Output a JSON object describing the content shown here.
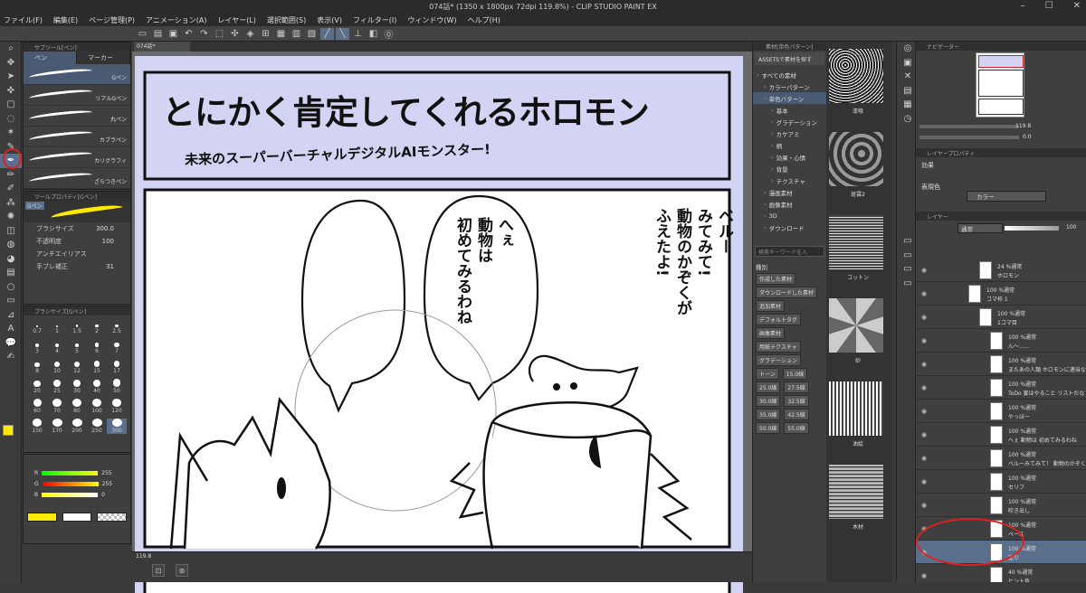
{
  "app": {
    "title": "074話* (1350 x 1800px 72dpi 119.8%) - CLIP STUDIO PAINT EX"
  },
  "menu": [
    "ファイル(F)",
    "編集(E)",
    "ページ管理(P)",
    "アニメーション(A)",
    "レイヤー(L)",
    "選択範囲(S)",
    "表示(V)",
    "フィルター(I)",
    "ウィンドウ(W)",
    "ヘルプ(H)"
  ],
  "tool_panel": {
    "header": "サブツール[ペン]",
    "tabs": [
      "ペン",
      "マーカー"
    ],
    "brushes": [
      "Gペン",
      "リアルGペン",
      "丸ペン",
      "カブラペン",
      "カリグラフィ",
      "ざらつきペン"
    ]
  },
  "tool_property": {
    "header": "ツールプロパティ[Gペン]",
    "brush_name": "Gペン",
    "rows": [
      {
        "label": "ブラシサイズ",
        "value": "300.0"
      },
      {
        "label": "不透明度",
        "value": "100"
      },
      {
        "label": "アンチエイリアス",
        "value": ""
      },
      {
        "label": "手ブレ補正",
        "value": "31"
      }
    ]
  },
  "brush_size": {
    "header": "ブラシサイズ[Gペン]",
    "sizes": [
      "0.7",
      "1",
      "1.5",
      "2",
      "2.5",
      "3",
      "4",
      "5",
      "6",
      "7",
      "8",
      "10",
      "12",
      "15",
      "17",
      "20",
      "25",
      "30",
      "40",
      "50",
      "60",
      "70",
      "80",
      "100",
      "120",
      "150",
      "170",
      "200",
      "250",
      "300"
    ],
    "selected": "300"
  },
  "color": {
    "main": "#ffea00",
    "sub": "#ffffff",
    "rgb": [
      {
        "label": "R",
        "value": "255"
      },
      {
        "label": "G",
        "value": "255"
      },
      {
        "label": "B",
        "value": "0"
      }
    ]
  },
  "document": {
    "tab": "074話*",
    "zoom": "119.8",
    "title_main": "とにかく肯定してくれるホロモン",
    "title_sub": "未来のスーパーバーチャルデジタルAIモンスター!",
    "bubble_left": [
      "へぇ",
      "動物は",
      "初めてみるわね"
    ],
    "bubble_right": [
      "ベルー",
      "みてみて!",
      "動物のかぞくが",
      "ふえたよ!"
    ]
  },
  "materials": {
    "header": "素材[単色パターン]",
    "assets_button": "ASSETSで素材を探す",
    "tree": [
      {
        "label": "すべての素材",
        "level": 0
      },
      {
        "label": "カラーパターン",
        "level": 1
      },
      {
        "label": "単色パターン",
        "level": 1,
        "selected": true
      },
      {
        "label": "基本",
        "level": 2
      },
      {
        "label": "グラデーション",
        "level": 2
      },
      {
        "label": "カケアミ",
        "level": 2
      },
      {
        "label": "柄",
        "level": 2
      },
      {
        "label": "効果・心情",
        "level": 2
      },
      {
        "label": "背景",
        "level": 2
      },
      {
        "label": "テクスチャ",
        "level": 2
      },
      {
        "label": "漫画素材",
        "level": 1
      },
      {
        "label": "画像素材",
        "level": 1
      },
      {
        "label": "3D",
        "level": 1
      },
      {
        "label": "ダウンロード",
        "level": 1
      }
    ],
    "search_placeholder": "検索キーワードを入",
    "tag_header": "種別",
    "tags": [
      "作成した素材",
      "ダウンロードした素材",
      "追加素材",
      "デフォルトタグ",
      "画像素材",
      "用紙テクスチャ",
      "グラデーション",
      "トーン",
      "15.0線",
      "25.0線",
      "27.5線",
      "30.0線",
      "32.5線",
      "35.0線",
      "42.5線",
      "50.0線",
      "55.0線"
    ],
    "textures": [
      "漆喰",
      "斑雲2",
      "コットン",
      "砂",
      "油絵",
      "木材"
    ]
  },
  "navigator": {
    "header": "ナビゲーター",
    "zoom": "119.8",
    "angle": "0.0"
  },
  "layer_property": {
    "header": "レイヤープロパティ",
    "effect_label": "効果",
    "color_label": "表現色",
    "color_value": "カラー"
  },
  "layers": {
    "header": "レイヤー",
    "blend": "通常",
    "opacity": "100",
    "items": [
      {
        "line1": "24 %通常",
        "line2": "ホロモン",
        "indent": 1
      },
      {
        "line1": "100 %通常",
        "line2": "コマ枠 1",
        "indent": 0
      },
      {
        "line1": "100 %通常",
        "line2": "1コマ目",
        "indent": 1
      },
      {
        "line1": "100 %通常",
        "line2": "ん～……",
        "indent": 2
      },
      {
        "line1": "100 %通常",
        "line2": "またあの人類 ホロモンに適当なこと教えて",
        "indent": 2
      },
      {
        "line1": "100 %通常",
        "line2": "ToDo 宴はやること リストだな",
        "indent": 2
      },
      {
        "line1": "100 %通常",
        "line2": "やっほー",
        "indent": 2
      },
      {
        "line1": "100 %通常",
        "line2": "へぇ 動物は 初めてみるわね",
        "indent": 2
      },
      {
        "line1": "100 %通常",
        "line2": "ベルーみてみて！ 動物のかぞくがふえたよ！",
        "indent": 2
      },
      {
        "line1": "100 %通常",
        "line2": "セリフ",
        "indent": 2
      },
      {
        "line1": "100 %通常",
        "line2": "吹き出し",
        "indent": 2
      },
      {
        "line1": "100 %通常",
        "line2": "ベース",
        "indent": 2
      },
      {
        "line1": "100 %通常",
        "line2": "塗り",
        "indent": 2,
        "selected": true
      },
      {
        "line1": "40 %通常",
        "line2": "ヒント色",
        "indent": 2
      }
    ]
  }
}
